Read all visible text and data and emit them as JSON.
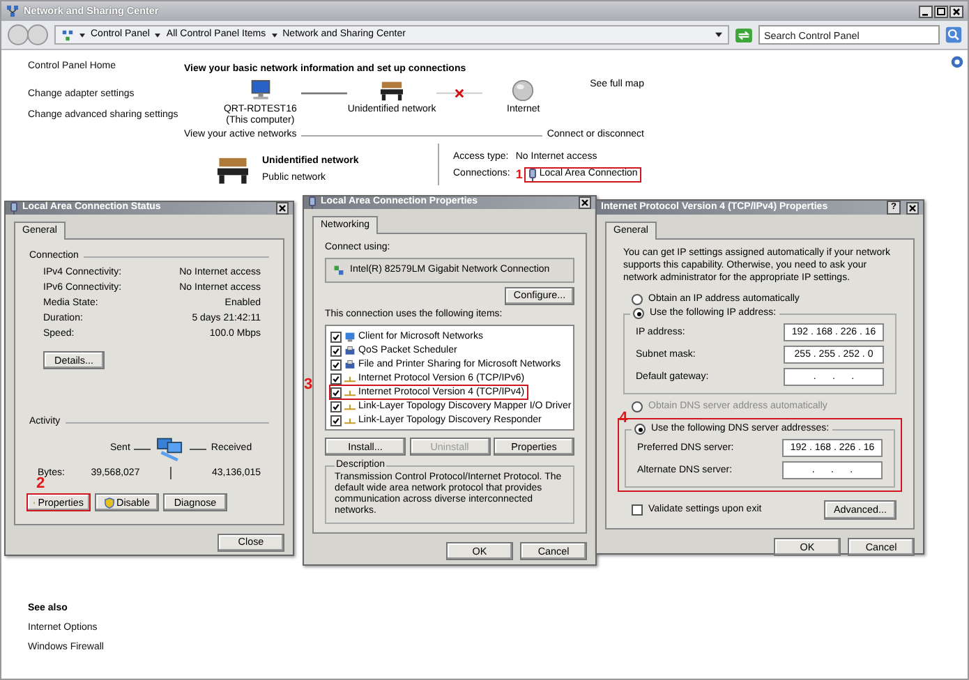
{
  "window": {
    "title": "Network and Sharing Center"
  },
  "address_bar": {
    "crumbs": [
      "Control Panel",
      "All Control Panel Items",
      "Network and Sharing Center"
    ]
  },
  "search": {
    "placeholder": "Search Control Panel"
  },
  "sidebar": {
    "items": [
      "Control Panel Home",
      "Change adapter settings",
      "Change advanced sharing settings"
    ]
  },
  "see_also": {
    "heading": "See also",
    "links": [
      "Internet Options",
      "Windows Firewall"
    ]
  },
  "main": {
    "heading": "View your basic network information and set up connections",
    "full_map_link": "See full map",
    "map_nodes": [
      {
        "kind": "computer",
        "label": "QRT-RDTEST16",
        "sublabel": "(This computer)"
      },
      {
        "kind": "network",
        "label": "Unidentified network"
      },
      {
        "kind": "internet",
        "label": "Internet"
      }
    ],
    "map_links": [
      {
        "kind": "connected"
      },
      {
        "kind": "broken"
      }
    ],
    "active_label": "View your active networks",
    "connect_link": "Connect or disconnect",
    "network": {
      "name": "Unidentified network",
      "category": "Public network",
      "access_label": "Access type:",
      "access_value": "No Internet access",
      "connections_label": "Connections:",
      "connection": {
        "text": "Local Area Connection",
        "highlighted": true,
        "marker": "1"
      }
    }
  },
  "status_dialog": {
    "title": "Local Area Connection Status",
    "tab": "General",
    "connection_heading": "Connection",
    "rows": [
      {
        "label": "IPv4 Connectivity:",
        "value": "No Internet access"
      },
      {
        "label": "IPv6 Connectivity:",
        "value": "No Internet access"
      },
      {
        "label": "Media State:",
        "value": "Enabled"
      },
      {
        "label": "Duration:",
        "value": "5 days 21:42:11"
      },
      {
        "label": "Speed:",
        "value": "100.0 Mbps"
      }
    ],
    "details_button": "Details...",
    "activity_heading": "Activity",
    "sent_label": "Sent",
    "received_label": "Received",
    "bytes_label": "Bytes:",
    "sent_bytes": "39,568,027",
    "received_bytes": "43,136,015",
    "buttons": [
      {
        "label": "Properties",
        "shield": true,
        "highlighted": true,
        "marker": "2"
      },
      {
        "label": "Disable",
        "shield": true,
        "highlighted": false
      },
      {
        "label": "Diagnose",
        "shield": false,
        "highlighted": false
      }
    ],
    "close_button": "Close"
  },
  "properties_dialog": {
    "title": "Local Area Connection Properties",
    "tab": "Networking",
    "connect_using_label": "Connect using:",
    "adapter": "Intel(R) 82579LM Gigabit Network Connection",
    "configure_button": "Configure...",
    "items_label": "This connection uses the following items:",
    "items": [
      {
        "kind": "client",
        "label": "Client for Microsoft Networks",
        "checked": true,
        "highlighted": false
      },
      {
        "kind": "service",
        "label": "QoS Packet Scheduler",
        "checked": true,
        "highlighted": false
      },
      {
        "kind": "service",
        "label": "File and Printer Sharing for Microsoft Networks",
        "checked": true,
        "highlighted": false
      },
      {
        "kind": "protocol",
        "label": "Internet Protocol Version 6 (TCP/IPv6)",
        "checked": true,
        "highlighted": false
      },
      {
        "kind": "protocol",
        "label": "Internet Protocol Version 4 (TCP/IPv4)",
        "checked": true,
        "highlighted": true,
        "marker": "3"
      },
      {
        "kind": "protocol",
        "label": "Link-Layer Topology Discovery Mapper I/O Driver",
        "checked": true,
        "highlighted": false
      },
      {
        "kind": "protocol",
        "label": "Link-Layer Topology Discovery Responder",
        "checked": true,
        "highlighted": false
      }
    ],
    "buttons": [
      {
        "label": "Install...",
        "disabled": false
      },
      {
        "label": "Uninstall",
        "disabled": true
      },
      {
        "label": "Properties",
        "disabled": false
      }
    ],
    "description_label": "Description",
    "description": "Transmission Control Protocol/Internet Protocol. The default wide area network protocol that provides communication across diverse interconnected networks.",
    "ok_button": "OK",
    "cancel_button": "Cancel"
  },
  "ipv4_dialog": {
    "title": "Internet Protocol Version 4 (TCP/IPv4) Properties",
    "help_button": "?",
    "tab": "General",
    "intro": "You can get IP settings assigned automatically if your network supports this capability. Otherwise, you need to ask your network administrator for the appropriate IP settings.",
    "ip_auto": {
      "label": "Obtain an IP address automatically",
      "selected": false
    },
    "ip_manual": {
      "label": "Use the following IP address:",
      "selected": true
    },
    "ip_fields": [
      {
        "label": "IP address:",
        "value": "192 . 168 . 226 . 16"
      },
      {
        "label": "Subnet mask:",
        "value": "255 . 255 . 252 . 0"
      },
      {
        "label": "Default gateway:",
        "value": ".      .      ."
      }
    ],
    "dns_auto": {
      "label": "Obtain DNS server address automatically",
      "selected": false
    },
    "dns_manual": {
      "label": "Use the following DNS server addresses:",
      "selected": true,
      "highlighted": true,
      "marker": "4"
    },
    "dns_fields": [
      {
        "label": "Preferred DNS server:",
        "value": "192 . 168 . 226 . 16"
      },
      {
        "label": "Alternate DNS server:",
        "value": ".      .      ."
      }
    ],
    "validate": {
      "label": "Validate settings upon exit",
      "checked": false
    },
    "advanced_button": "Advanced...",
    "ok_button": "OK",
    "cancel_button": "Cancel"
  }
}
